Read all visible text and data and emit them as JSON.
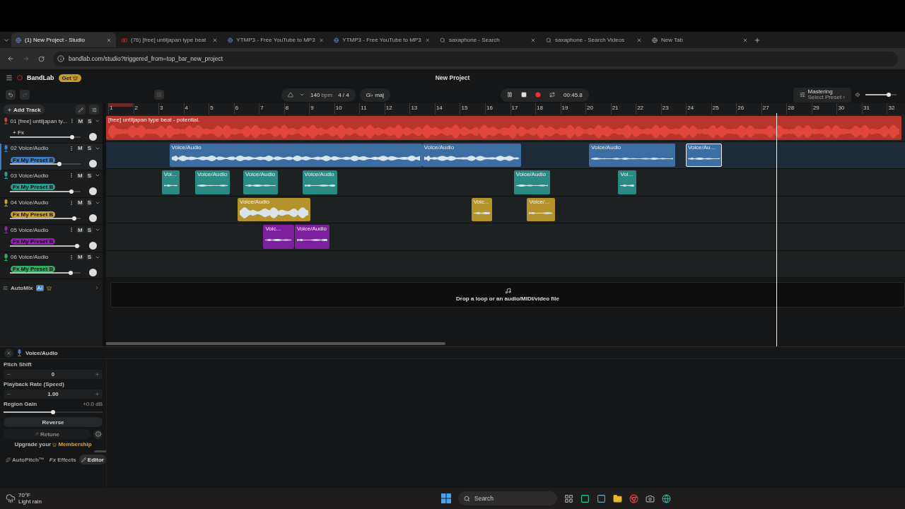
{
  "browser": {
    "tabs": [
      {
        "title": "(1) New Project - Studio",
        "selected": true
      },
      {
        "title": "(76) [free] untiljapan type beat",
        "selected": false
      },
      {
        "title": "YTMP3 - Free YouTube to MP3",
        "selected": false
      },
      {
        "title": "YTMP3 - Free YouTube to MP3",
        "selected": false
      },
      {
        "title": "saxaphone - Search",
        "selected": false
      },
      {
        "title": "saxaphone - Search Videos",
        "selected": false
      },
      {
        "title": "New Tab",
        "selected": false
      }
    ],
    "url": "bandlab.com/studio?triggered_from=top_bar_new_project"
  },
  "header": {
    "brand": "BandLab",
    "get_badge": "Get",
    "project_title": "New Project"
  },
  "toolbar": {
    "tempo": "140",
    "tempo_unit": "bpm",
    "time_signature": "4 / 4",
    "key": "G♭ maj",
    "time": "00:45.8",
    "mastering": "Mastering",
    "mastering_preset": "Select Preset ›",
    "master_volume": {
      "level": 0.75
    }
  },
  "add_track": "Add Track",
  "ruler": [
    "1",
    "2",
    "3",
    "4",
    "5",
    "6",
    "7",
    "8",
    "9",
    "10",
    "11",
    "12",
    "13",
    "14",
    "15",
    "16",
    "17",
    "18",
    "19",
    "20",
    "21",
    "22",
    "23",
    "24",
    "25",
    "26",
    "27",
    "28",
    "29",
    "30",
    "31",
    "32"
  ],
  "tracks": [
    {
      "number": "01",
      "name": "[free] untiljapan ty...",
      "color": "#d0413a",
      "selected": false,
      "fx": {
        "kind": "add",
        "label": "+ Fx"
      },
      "mute": "M",
      "solo": "S",
      "volume": {
        "level": 0.88
      },
      "clips": [
        {
          "label": "[free] untiljapan type beat - potential.",
          "selected": false
        }
      ]
    },
    {
      "number": "02",
      "name": "Voice/Audio",
      "color": "#3d7cc4",
      "selected": true,
      "fx": {
        "kind": "preset",
        "label": "Fx My Preset B"
      },
      "mute": "M",
      "solo": "S",
      "volume": {
        "level": 0.7
      },
      "clips": [
        {
          "label": "Voice/Audio",
          "selected": false
        },
        {
          "label": "Voice/Audio",
          "selected": false
        },
        {
          "label": "Voice/Audio",
          "selected": false
        },
        {
          "label": "Voice/Au...",
          "selected": true
        }
      ]
    },
    {
      "number": "03",
      "name": "Voice/Audio",
      "color": "#2a9d90",
      "selected": false,
      "fx": {
        "kind": "preset",
        "label": "Fx My Preset B"
      },
      "mute": "M",
      "solo": "S",
      "volume": {
        "level": 0.87
      },
      "clips": [
        {
          "label": "Voi...",
          "selected": false
        },
        {
          "label": "Voice/Audio",
          "selected": false
        },
        {
          "label": "Voice/Audio",
          "selected": false
        },
        {
          "label": "Voice/Audio",
          "selected": false
        },
        {
          "label": "Voice/Audio",
          "selected": false
        },
        {
          "label": "Voi...",
          "selected": false
        }
      ]
    },
    {
      "number": "04",
      "name": "Voice/Audio",
      "color": "#c9a22e",
      "selected": false,
      "fx": {
        "kind": "preset",
        "label": "Fx My Preset B"
      },
      "mute": "M",
      "solo": "S",
      "volume": {
        "level": 0.91
      },
      "clips": [
        {
          "label": "Voice/Audio",
          "selected": false
        },
        {
          "label": "Voic...",
          "selected": false
        },
        {
          "label": "Voice/...",
          "selected": false
        }
      ]
    },
    {
      "number": "05",
      "name": "Voice/Audio",
      "color": "#8e24aa",
      "selected": false,
      "fx": {
        "kind": "preset",
        "label": "Fx My Preset B"
      },
      "mute": "M",
      "solo": "S",
      "volume": {
        "level": 0.95
      },
      "clips": [
        {
          "label": "Voic...",
          "selected": false
        },
        {
          "label": "Voice/Audio",
          "selected": false
        }
      ]
    },
    {
      "number": "06",
      "name": "Voice/Audio",
      "color": "#2fae62",
      "selected": false,
      "fx": {
        "kind": "preset",
        "label": "Fx My Preset B"
      },
      "mute": "M",
      "solo": "S",
      "volume": {
        "level": 0.86
      }
    }
  ],
  "automix": {
    "label": "AutoMix",
    "badge": "AI"
  },
  "drop_zone": "Drop a loop or an audio/MIDI/video file",
  "editor": {
    "title": "Voice/Audio",
    "pitch_shift": {
      "label": "Pitch Shift",
      "value": "0"
    },
    "playback_rate": {
      "label": "Playback Rate (Speed)",
      "value": "1.00"
    },
    "region_gain": {
      "label": "Region Gain",
      "reading": "+0.0 dB",
      "level": 0.5
    },
    "reverse": "Reverse",
    "retune": {
      "label": "Retune",
      "disabled": true
    },
    "upgrade_text": "Upgrade your",
    "upgrade_link": "Membership",
    "tabs": [
      {
        "label": "AutoPitch™",
        "selected": false
      },
      {
        "label": "Effects",
        "prefix": "Fx",
        "selected": false
      },
      {
        "label": "Editor",
        "selected": true
      }
    ]
  },
  "taskbar": {
    "temperature": "70°F",
    "condition": "Light rain",
    "search": "Search"
  }
}
